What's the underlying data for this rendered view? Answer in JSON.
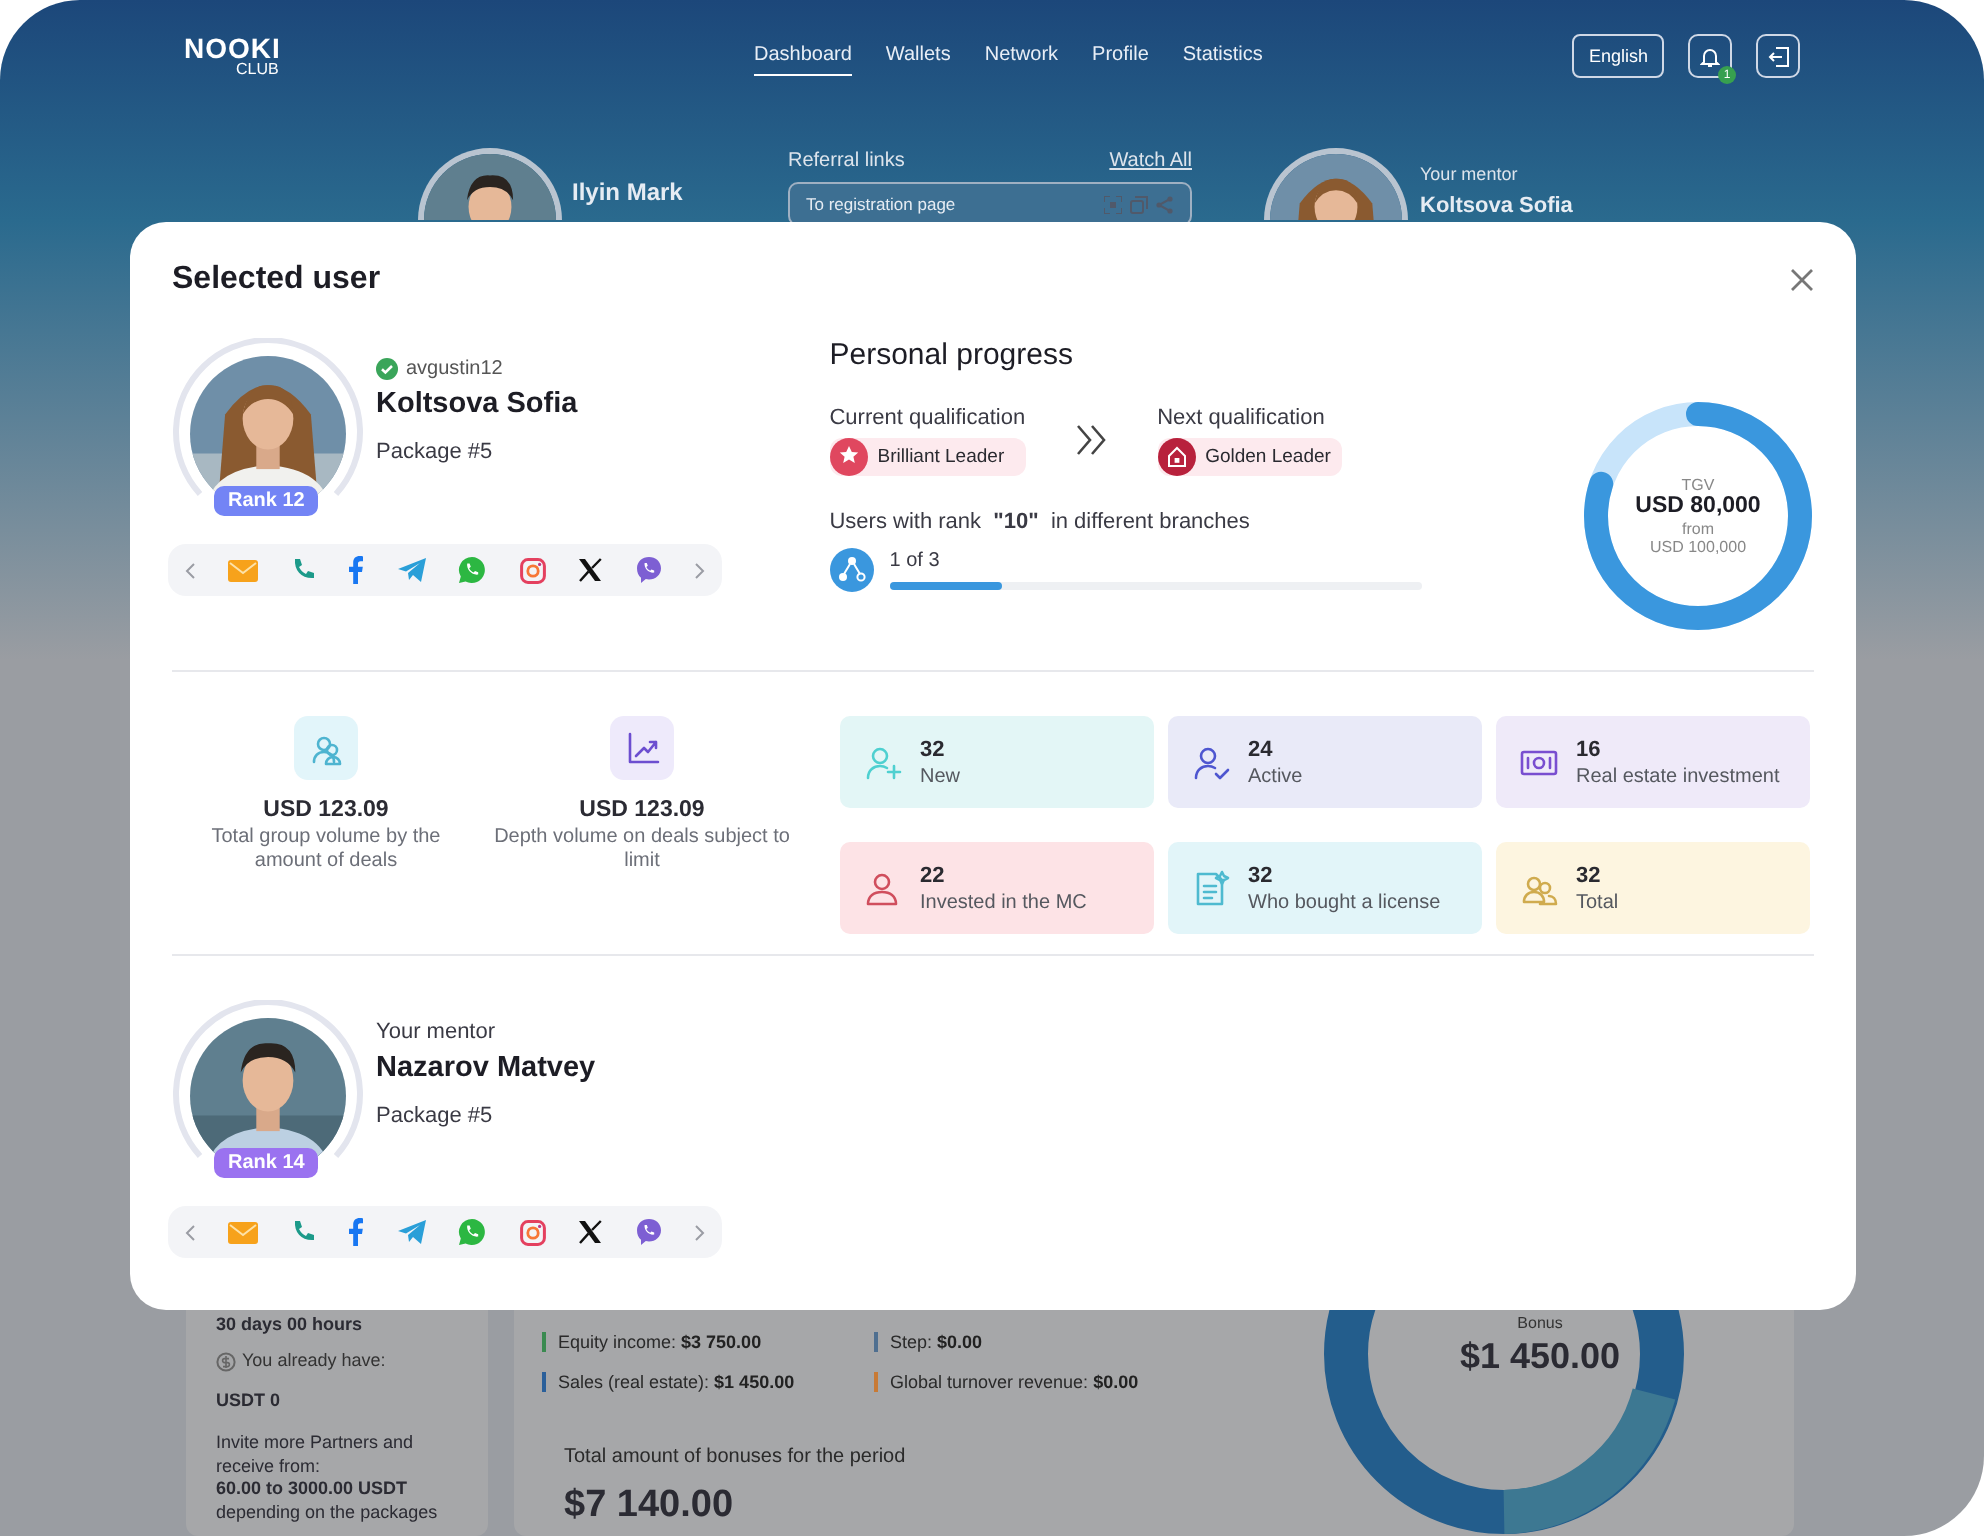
{
  "header": {
    "logo": "NOOKI",
    "logo_sub": "CLUB",
    "nav": [
      {
        "label": "Dashboard",
        "selected": true
      },
      {
        "label": "Wallets",
        "selected": false
      },
      {
        "label": "Network",
        "selected": false
      },
      {
        "label": "Profile",
        "selected": false
      },
      {
        "label": "Statistics",
        "selected": false
      }
    ],
    "language": "English",
    "notifications": "1"
  },
  "profile": {
    "name": "Ilyin Mark"
  },
  "referral": {
    "title": "Referral links",
    "watch_all": "Watch All",
    "link": "To registration page"
  },
  "mentor_card": {
    "label": "Your mentor",
    "name": "Koltsova Sofia"
  },
  "bonus_panel": {
    "timer": "30 days 00 hours",
    "have_label": "You already have:",
    "have_value": "USDT 0",
    "invite": "Invite more Partners and receive from:",
    "range": "60.00 to 3000.00 USDT",
    "packages": "depending on the packages"
  },
  "income": [
    {
      "label": "Equity income:",
      "value": "$3 750.00",
      "color": "#3a8a50"
    },
    {
      "label": "Step:",
      "value": "$0.00",
      "color": "#4f6f90"
    },
    {
      "label": "Sales (real estate):",
      "value": "$1 450.00",
      "color": "#2a5f9a"
    },
    {
      "label": "Global turnover revenue:",
      "value": "$0.00",
      "color": "#c87a35"
    }
  ],
  "total": {
    "label": "Total amount of bonuses for the period",
    "value": "$7 140.00"
  },
  "bonus_donut": {
    "label": "Bonus",
    "value": "$1 450.00"
  },
  "modal": {
    "title": "Selected user",
    "user": {
      "verified": true,
      "login": "avgustin12",
      "name": "Koltsova Sofia",
      "package": "Package #5",
      "rank": "Rank 12"
    },
    "progress": {
      "title": "Personal progress",
      "current_label": "Current qualification",
      "current": "Brilliant Leader",
      "next_label": "Next qualification",
      "next": "Golden Leader",
      "branches_text": "Users with rank  **\"10\"**  in different branches",
      "branches_count": "1 of 3",
      "level": 0.21
    },
    "tgv": {
      "label": "TGV",
      "value": "USD 80,000",
      "from": "from",
      "target": "USD 100,000",
      "level": 0.8
    },
    "volumes": [
      {
        "kind": "group",
        "value": "USD 123.09",
        "label": "Total group volume by the amount of deals",
        "color": "#e2f5fa"
      },
      {
        "kind": "depth",
        "value": "USD 123.09",
        "label": "Depth volume on deals subject to limit",
        "color": "#eeeafb"
      }
    ],
    "counters": [
      {
        "kind": "new",
        "value": "32",
        "label": "New",
        "color": "#e3f6f6"
      },
      {
        "kind": "active",
        "value": "24",
        "label": "Active",
        "color": "#e9eaf8"
      },
      {
        "kind": "investment",
        "value": "16",
        "label": "Real estate investment",
        "color": "#efeaf9"
      },
      {
        "kind": "invested",
        "value": "22",
        "label": "Invested in the MC",
        "color": "#fde3e6"
      },
      {
        "kind": "license",
        "value": "32",
        "label": "Who bought a license",
        "color": "#e2f5f9"
      },
      {
        "kind": "total",
        "value": "32",
        "label": "Total",
        "color": "#fdf5e0"
      }
    ],
    "mentor": {
      "label": "Your mentor",
      "name": "Nazarov Matvey",
      "package": "Package #5",
      "rank": "Rank 14"
    }
  }
}
